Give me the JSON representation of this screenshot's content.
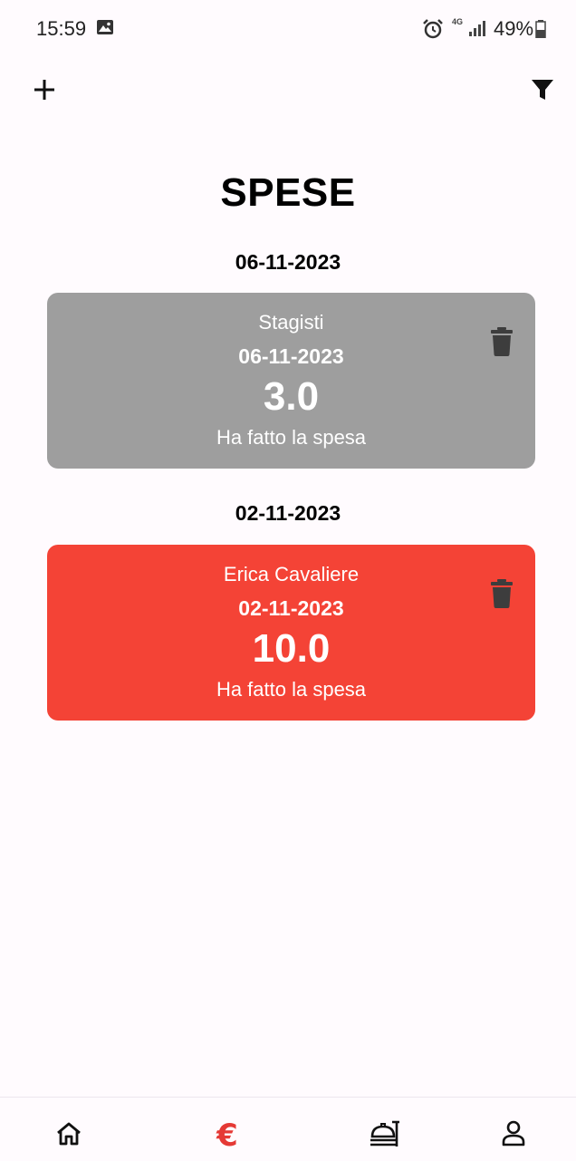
{
  "status_bar": {
    "time": "15:59",
    "network": "4G",
    "battery": "49%"
  },
  "toolbar": {
    "add_icon": "plus-icon",
    "filter_icon": "filter-icon"
  },
  "page": {
    "title": "SPESE"
  },
  "groups": [
    {
      "date": "06-11-2023",
      "card": {
        "name": "Stagisti",
        "date": "06-11-2023",
        "amount": "3.0",
        "description": "Ha fatto la spesa",
        "color": "#9e9e9e"
      }
    },
    {
      "date": "02-11-2023",
      "card": {
        "name": "Erica Cavaliere",
        "date": "02-11-2023",
        "amount": "10.0",
        "description": "Ha fatto la spesa",
        "color": "#f44336"
      }
    }
  ],
  "bottom_nav": {
    "items": [
      {
        "icon": "home-icon",
        "active": false
      },
      {
        "icon": "euro-icon",
        "glyph": "€",
        "active": true
      },
      {
        "icon": "food-icon",
        "active": false
      },
      {
        "icon": "profile-icon",
        "active": false
      }
    ],
    "active_color": "#e53935",
    "inactive_color": "#111111"
  }
}
